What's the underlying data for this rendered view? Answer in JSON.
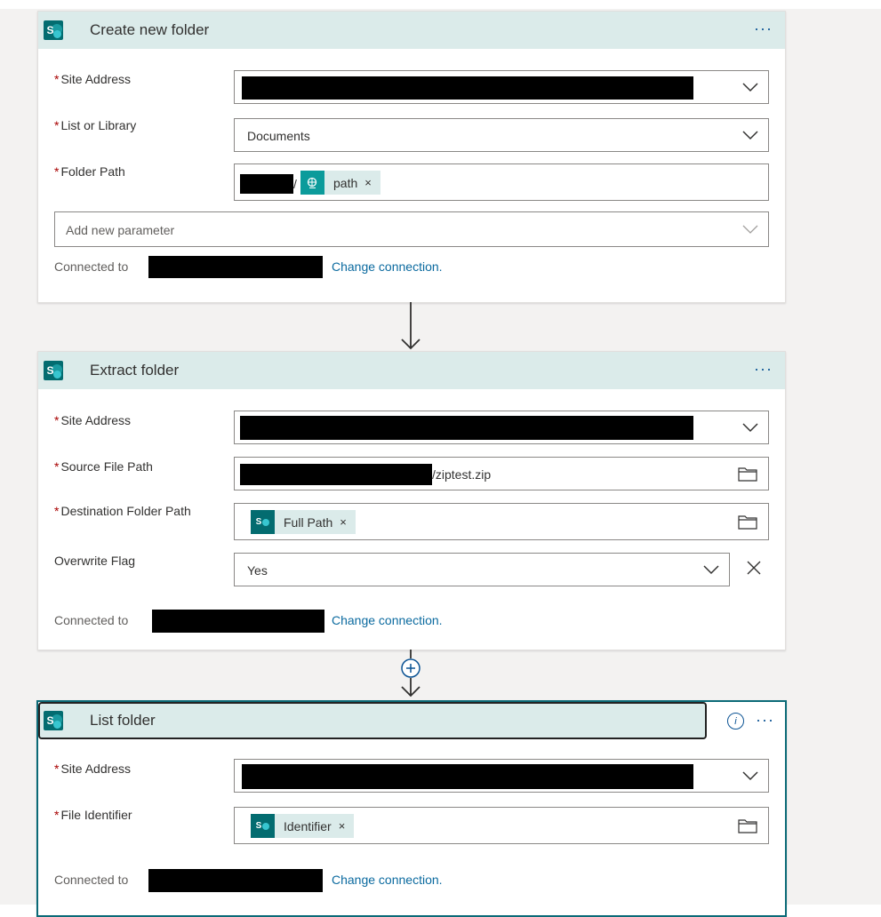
{
  "card1": {
    "title": "Create new folder",
    "more": "···",
    "site_label": "Site Address",
    "list_label": "List or Library",
    "list_value": "Documents",
    "folder_label": "Folder Path",
    "folder_sep": "/",
    "folder_token": "path",
    "token_close": "×",
    "add_param_placeholder": "Add new parameter",
    "connected": "Connected to",
    "change": "Change connection."
  },
  "card2": {
    "title": "Extract folder",
    "more": "···",
    "site_label": "Site Address",
    "source_label": "Source File Path",
    "source_suffix": "/ziptest.zip",
    "dest_label": "Destination Folder Path",
    "dest_token": "Full Path",
    "token_close": "×",
    "overwrite_label": "Overwrite Flag",
    "overwrite_value": "Yes",
    "connected": "Connected to",
    "change": "Change connection."
  },
  "card3": {
    "title": "List folder",
    "more": "···",
    "info": "i",
    "site_label": "Site Address",
    "file_label": "File Identifier",
    "file_token": "Identifier",
    "token_close": "×",
    "connected": "Connected to",
    "change": "Change connection."
  },
  "required_marker": "*",
  "icons": {
    "connector": "sharepoint-icon",
    "dropdown": "chevron-down-icon",
    "folder": "folder-icon",
    "expression": "globe-icon",
    "clear": "close-icon",
    "add_step": "plus-circle-icon"
  },
  "colors": {
    "header_bg": "#dbebea",
    "sharepoint": "#036c70",
    "link": "#0b6a9f",
    "required": "#a80000"
  }
}
